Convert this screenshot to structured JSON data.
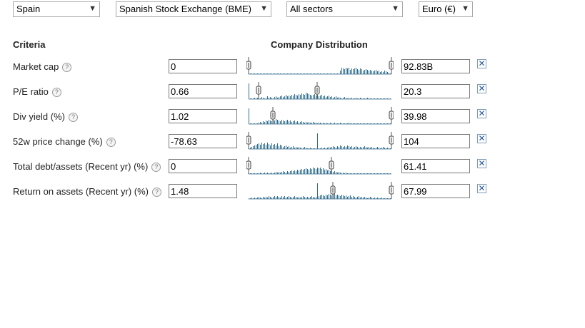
{
  "filters": {
    "country": "Spain",
    "exchange": "Spanish Stock Exchange (BME)",
    "sector": "All sectors",
    "currency": "Euro (€)"
  },
  "headers": {
    "criteria": "Criteria",
    "distribution": "Company Distribution"
  },
  "rows": [
    {
      "label": "Market cap",
      "min": "0",
      "max": "92.83B",
      "min_handle": 0.0,
      "max_handle": 1.0,
      "bars": [
        1,
        1,
        1,
        1,
        1,
        1,
        1,
        1,
        1,
        1,
        1,
        1,
        1,
        1,
        1,
        1,
        1,
        1,
        1,
        1,
        1,
        1,
        1,
        1,
        1,
        1,
        1,
        1,
        1,
        1,
        1,
        1,
        1,
        1,
        1,
        1,
        1,
        1,
        1,
        1,
        1,
        1,
        1,
        1,
        1,
        1,
        1,
        1,
        1,
        1,
        1,
        1,
        1,
        1,
        1,
        1,
        1,
        1,
        1,
        1,
        1,
        1,
        1,
        1,
        5,
        9,
        8,
        7,
        9,
        8,
        9,
        6,
        8,
        7,
        8,
        9,
        7,
        6,
        8,
        7,
        5,
        6,
        7,
        6,
        5,
        6,
        5,
        4,
        5,
        6,
        4,
        5,
        3,
        4,
        3,
        5,
        4,
        3,
        2,
        1
      ]
    },
    {
      "label": "P/E ratio",
      "min": "0.66",
      "max": "20.3",
      "min_handle": 0.07,
      "max_handle": 0.48,
      "bars": [
        22,
        1,
        1,
        1,
        2,
        1,
        2,
        1,
        1,
        3,
        2,
        1,
        1,
        4,
        2,
        3,
        2,
        1,
        3,
        4,
        2,
        3,
        4,
        5,
        3,
        4,
        6,
        4,
        5,
        4,
        6,
        5,
        7,
        6,
        5,
        7,
        6,
        8,
        7,
        6,
        9,
        8,
        7,
        6,
        5,
        6,
        7,
        5,
        6,
        4,
        5,
        6,
        4,
        5,
        3,
        4,
        5,
        3,
        4,
        2,
        3,
        4,
        2,
        3,
        2,
        1,
        2,
        3,
        2,
        1,
        2,
        1,
        2,
        1,
        1,
        2,
        1,
        1,
        2,
        1,
        1,
        1,
        1,
        2,
        1,
        1,
        1,
        1,
        1,
        1,
        1,
        1,
        1,
        1,
        1,
        1,
        1,
        1,
        1,
        1
      ]
    },
    {
      "label": "Div yield (%)",
      "min": "1.02",
      "max": "39.98",
      "min_handle": 0.17,
      "max_handle": 1.0,
      "bars": [
        22,
        1,
        1,
        1,
        1,
        1,
        1,
        2,
        3,
        2,
        4,
        3,
        5,
        4,
        6,
        5,
        4,
        6,
        5,
        7,
        6,
        5,
        4,
        6,
        5,
        4,
        5,
        6,
        4,
        5,
        3,
        4,
        5,
        3,
        4,
        2,
        3,
        4,
        3,
        2,
        3,
        2,
        3,
        2,
        2,
        3,
        2,
        2,
        1,
        2,
        2,
        1,
        2,
        1,
        2,
        1,
        1,
        2,
        1,
        1,
        2,
        1,
        1,
        1,
        2,
        1,
        1,
        1,
        1,
        1,
        2,
        1,
        1,
        1,
        1,
        1,
        1,
        1,
        1,
        1,
        1,
        1,
        1,
        1,
        1,
        1,
        1,
        1,
        1,
        1,
        1,
        1,
        1,
        1,
        1,
        1,
        1,
        1,
        1,
        1
      ]
    },
    {
      "label": "52w price change (%)",
      "min": "-78.63",
      "max": "104",
      "min_handle": 0.0,
      "max_handle": 1.0,
      "bars": [
        1,
        2,
        3,
        4,
        5,
        6,
        7,
        8,
        6,
        9,
        7,
        8,
        6,
        9,
        7,
        5,
        8,
        6,
        7,
        5,
        8,
        4,
        6,
        5,
        3,
        4,
        5,
        3,
        4,
        2,
        3,
        4,
        2,
        3,
        2,
        3,
        2,
        1,
        2,
        3,
        2,
        1,
        1,
        2,
        1,
        1,
        1,
        1,
        22,
        1,
        1,
        2,
        1,
        2,
        1,
        2,
        3,
        2,
        3,
        4,
        3,
        2,
        4,
        3,
        5,
        4,
        3,
        4,
        3,
        5,
        4,
        3,
        4,
        2,
        3,
        4,
        3,
        2,
        3,
        2,
        3,
        4,
        3,
        2,
        3,
        2,
        3,
        2,
        1,
        2,
        3,
        2,
        1,
        2,
        3,
        2,
        1,
        2,
        1,
        1
      ]
    },
    {
      "label": "Total debt/assets (Recent yr) (%)",
      "min": "0",
      "max": "61.41",
      "min_handle": 0.0,
      "max_handle": 0.58,
      "bars": [
        1,
        1,
        1,
        1,
        1,
        1,
        1,
        1,
        2,
        1,
        1,
        2,
        1,
        2,
        1,
        1,
        2,
        1,
        2,
        3,
        2,
        3,
        2,
        3,
        4,
        3,
        2,
        4,
        3,
        4,
        5,
        4,
        5,
        4,
        6,
        5,
        6,
        7,
        6,
        7,
        8,
        7,
        6,
        8,
        7,
        9,
        8,
        7,
        9,
        8,
        9,
        7,
        8,
        6,
        7,
        5,
        6,
        4,
        5,
        3,
        4,
        3,
        2,
        3,
        2,
        1,
        2,
        1,
        2,
        1,
        1,
        1,
        1,
        1,
        1,
        1,
        1,
        1,
        1,
        1,
        1,
        1,
        1,
        1,
        1,
        1,
        1,
        1,
        1,
        1,
        1,
        1,
        1,
        1,
        1,
        1,
        1,
        1,
        1,
        1
      ]
    },
    {
      "label": "Return on assets (Recent yr) (%)",
      "min": "1.48",
      "max": "67.99",
      "min_handle": 0.59,
      "max_handle": 1.0,
      "bars": [
        1,
        1,
        2,
        1,
        2,
        1,
        2,
        3,
        2,
        1,
        3,
        2,
        3,
        2,
        4,
        3,
        2,
        3,
        4,
        3,
        4,
        3,
        2,
        4,
        3,
        4,
        2,
        3,
        4,
        3,
        2,
        3,
        4,
        3,
        2,
        3,
        2,
        3,
        4,
        3,
        2,
        3,
        2,
        3,
        4,
        3,
        2,
        3,
        22,
        4,
        5,
        6,
        5,
        4,
        6,
        5,
        7,
        6,
        5,
        6,
        7,
        5,
        6,
        5,
        4,
        6,
        5,
        4,
        5,
        3,
        4,
        5,
        3,
        4,
        3,
        2,
        3,
        4,
        2,
        3,
        2,
        3,
        2,
        1,
        2,
        3,
        2,
        1,
        2,
        1,
        2,
        1,
        1,
        2,
        1,
        1,
        1,
        1,
        1,
        1
      ]
    }
  ],
  "icons": {
    "help": "help-icon",
    "remove": "remove-icon",
    "dropdown": "chevron-down-icon"
  },
  "colors": {
    "bar": "#2f6f8f",
    "axis": "#6b8fa8"
  }
}
